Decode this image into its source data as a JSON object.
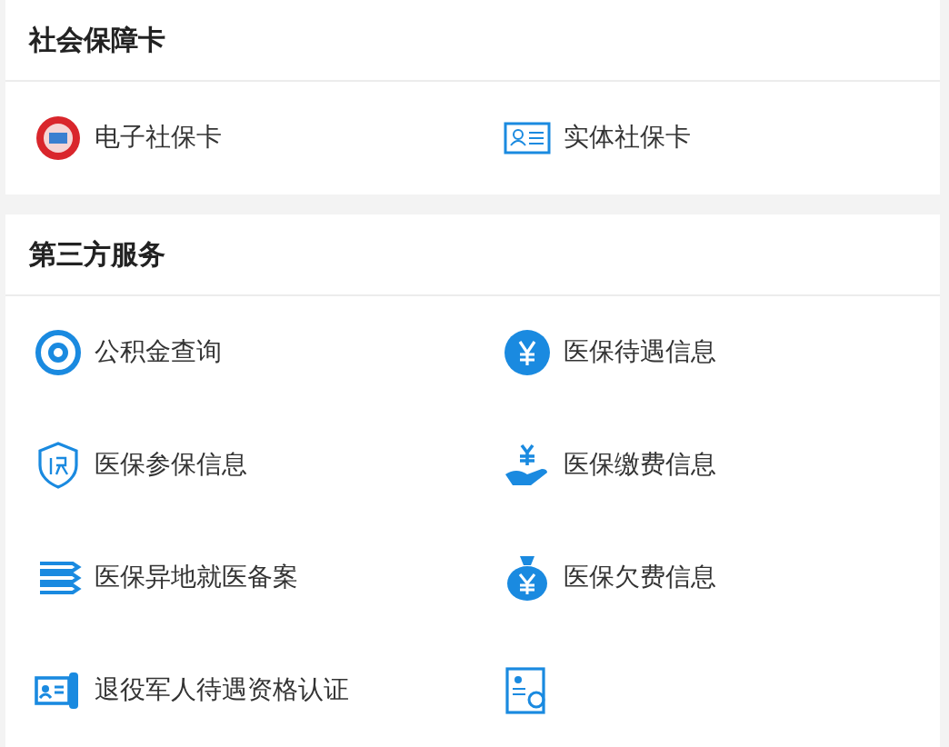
{
  "sections": [
    {
      "title": "社会保障卡",
      "items": [
        {
          "kind": "seal",
          "label": "电子社保卡"
        },
        {
          "kind": "idcard",
          "label": "实体社保卡"
        }
      ]
    },
    {
      "title": "第三方服务",
      "items": [
        {
          "kind": "fund",
          "label": "公积金查询"
        },
        {
          "kind": "yen",
          "label": "医保待遇信息"
        },
        {
          "kind": "shield",
          "label": "医保参保信息"
        },
        {
          "kind": "hand",
          "label": "医保缴费信息"
        },
        {
          "kind": "stack",
          "label": "医保异地就医备案"
        },
        {
          "kind": "bag",
          "label": "医保欠费信息"
        },
        {
          "kind": "veteran",
          "label": "退役军人待遇资格认证"
        },
        {
          "kind": "certificate"
        }
      ]
    }
  ]
}
